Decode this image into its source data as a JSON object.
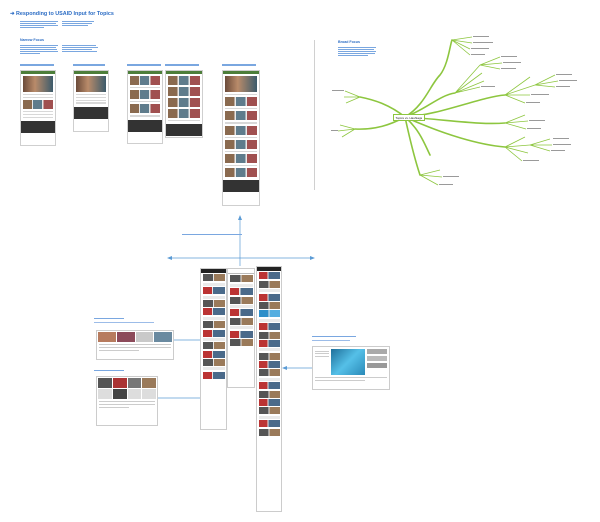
{
  "page_title": "Responding to USAID Input for Topics",
  "sections": {
    "narrow_focus": "Narrow Focus",
    "broad_focus": "Broad Focus"
  },
  "mindmap": {
    "center": "Topics vs. Hashtags"
  },
  "colors": {
    "accent": "#2b6cc4",
    "mindmap_green": "#8dc63f",
    "connector_blue": "#5b9bd5"
  }
}
